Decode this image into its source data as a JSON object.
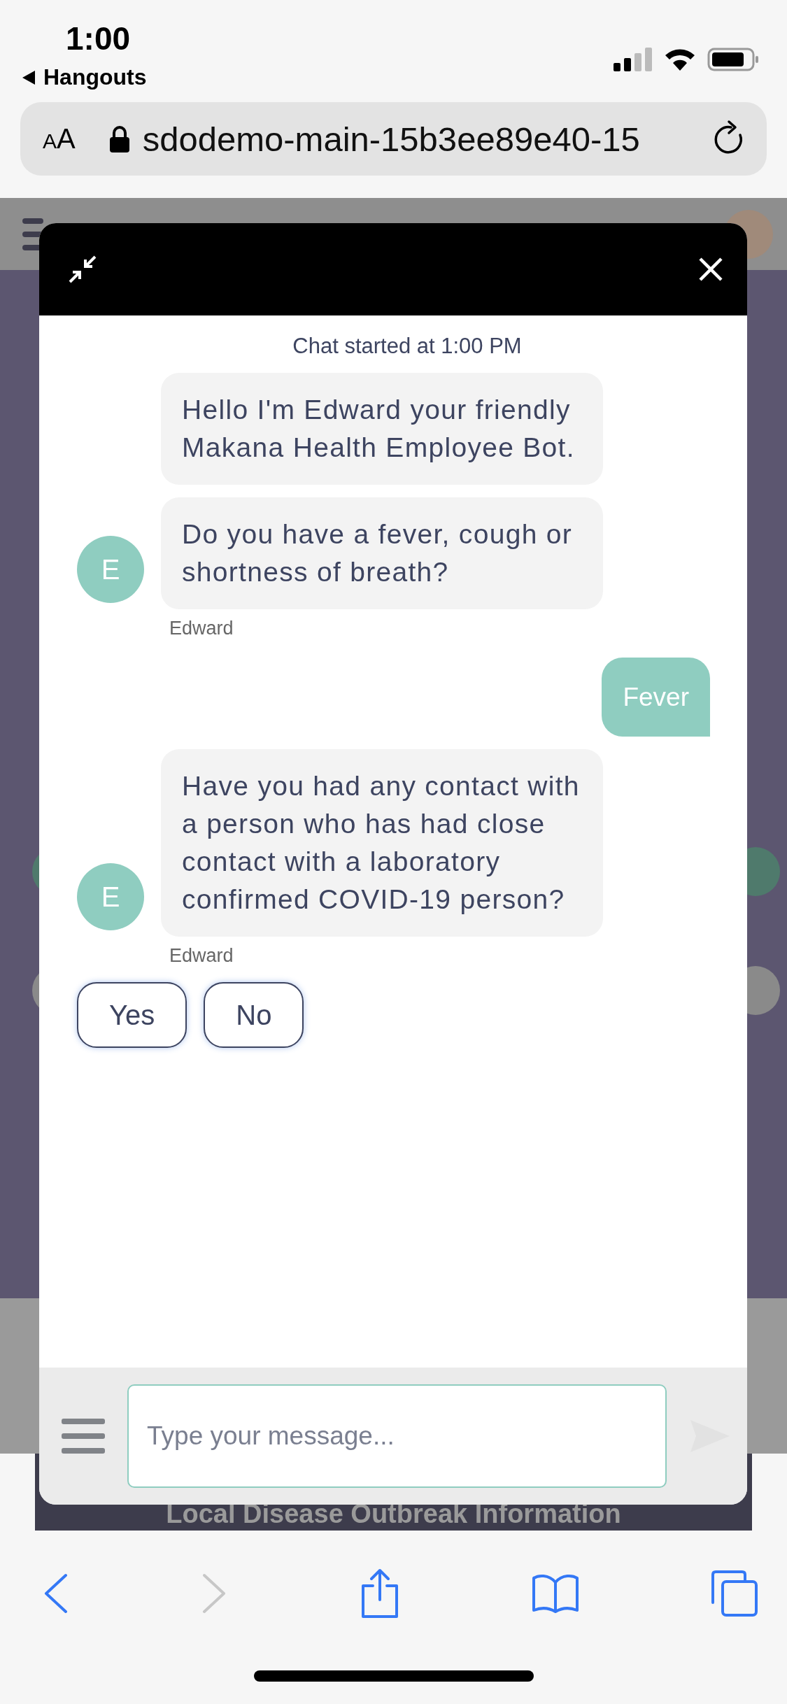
{
  "status_bar": {
    "time": "1:00",
    "back_app": "Hangouts"
  },
  "address_bar": {
    "text_size_small": "A",
    "text_size_large": "A",
    "url": "sdodemo-main-15b3ee89e40-15"
  },
  "background_page": {
    "banner": "Local Disease Outbreak Information"
  },
  "chat": {
    "started": "Chat started at 1:00 PM",
    "messages": [
      {
        "kind": "bot",
        "texts": [
          "Hello I'm Edward your friendly Makana Health Employee Bot.",
          "Do you have a fever, cough or shortness of breath?"
        ],
        "avatar": "E",
        "sender": "Edward"
      },
      {
        "kind": "user",
        "texts": [
          "Fever"
        ]
      },
      {
        "kind": "bot",
        "texts": [
          "Have you had any contact with a person who has had close contact with a laboratory confirmed COVID-19 person?"
        ],
        "avatar": "E",
        "sender": "Edward"
      }
    ],
    "quick_replies": [
      "Yes",
      "No"
    ],
    "input": {
      "placeholder": "Type your message..."
    }
  },
  "toolbar": [
    {
      "kind": "back",
      "disabled": false
    },
    {
      "kind": "forward",
      "disabled": true
    },
    {
      "kind": "share",
      "disabled": false
    },
    {
      "kind": "bookmarks",
      "disabled": false
    },
    {
      "kind": "tabs",
      "disabled": false
    }
  ]
}
